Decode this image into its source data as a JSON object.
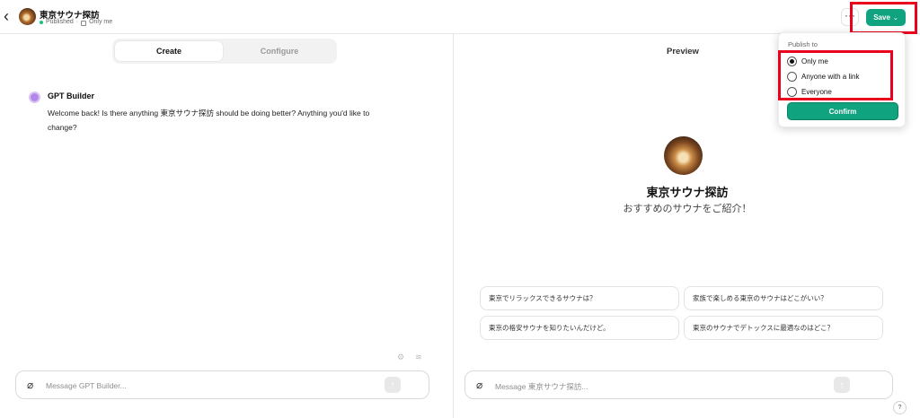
{
  "header": {
    "back_icon": "chevron-left-icon",
    "title": "東京サウナ探訪",
    "status": "Published",
    "visibility": "Only me",
    "more_label": "···",
    "save_label": "Save",
    "accent_color": "#10a37f",
    "highlight_color": "#e8001c"
  },
  "builder": {
    "tabs": [
      {
        "label": "Create",
        "active": true
      },
      {
        "label": "Configure",
        "active": false
      }
    ],
    "bot_name": "GPT Builder",
    "bot_message": "Welcome back! Is there anything 東京サウナ探訪 should be doing better? Anything you'd like to change?",
    "composer_placeholder": "Message GPT Builder...",
    "send_label": "↑"
  },
  "preview": {
    "title": "Preview",
    "gpt_name": "東京サウナ探訪",
    "gpt_description": "おすすめのサウナをご紹介！",
    "suggestions": [
      "東京でリラックスできるサウナは？",
      "家族で楽しめる東京のサウナはどこがいい？",
      "東京の格安サウナを知りたいんだけど。",
      "東京のサウナでデトックスに最適なのはどこ？"
    ],
    "composer_placeholder": "Message 東京サウナ探訪...",
    "send_label": "↑",
    "help_label": "?"
  },
  "publish_menu": {
    "label": "Publish to",
    "options": [
      {
        "label": "Only me",
        "selected": true
      },
      {
        "label": "Anyone with a link",
        "selected": false
      },
      {
        "label": "Everyone",
        "selected": false
      }
    ],
    "confirm_label": "Confirm"
  }
}
